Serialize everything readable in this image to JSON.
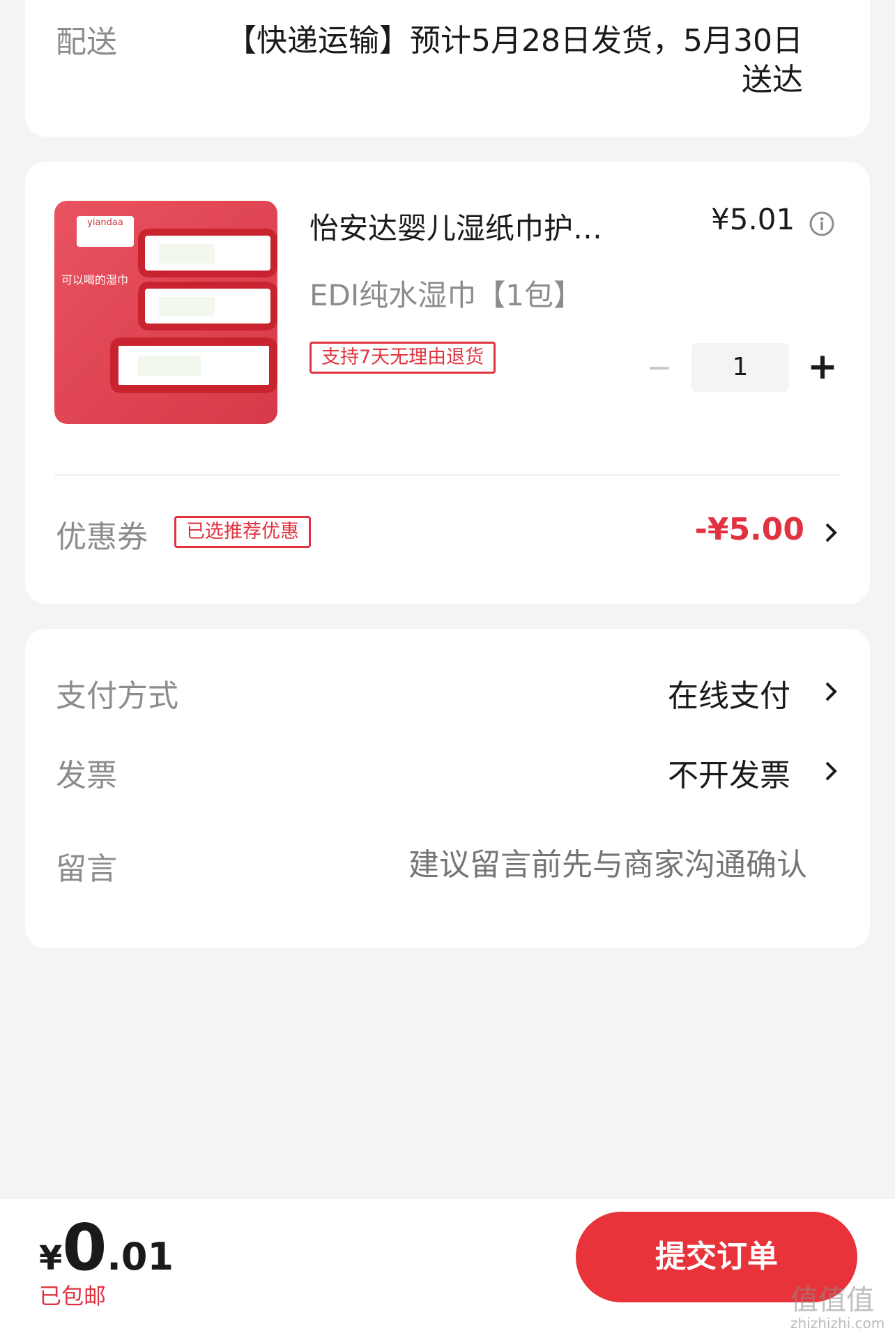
{
  "delivery": {
    "label": "配送",
    "line1": "【快递运输】预计5月28日发货，5月30日",
    "line2": "送达"
  },
  "product": {
    "name": "怡安达婴儿湿纸巾护…",
    "price": "¥5.01",
    "spec": "EDI纯水湿巾【1包】",
    "return_tag": "支持7天无理由退货",
    "quantity": "1",
    "qty_minus": "−",
    "qty_plus": "+",
    "image_caption": "可以喝的湿巾",
    "brand": "yiandaa"
  },
  "coupon": {
    "label": "优惠券",
    "tag": "已选推荐优惠",
    "amount": "-¥5.00"
  },
  "payment": {
    "label": "支付方式",
    "value": "在线支付"
  },
  "invoice": {
    "label": "发票",
    "value": "不开发票"
  },
  "message": {
    "label": "留言",
    "placeholder": "建议留言前先与商家沟通确认"
  },
  "footer": {
    "currency": "¥",
    "total_int": "0",
    "total_dec": ".01",
    "shipping_note": "已包邮",
    "submit_label": "提交订单"
  },
  "watermark": {
    "site": "zhizhizhi.com",
    "logo": "值值值"
  },
  "colors": {
    "accent": "#e0333f",
    "button": "#e8333b",
    "background": "#f4f4f6"
  }
}
